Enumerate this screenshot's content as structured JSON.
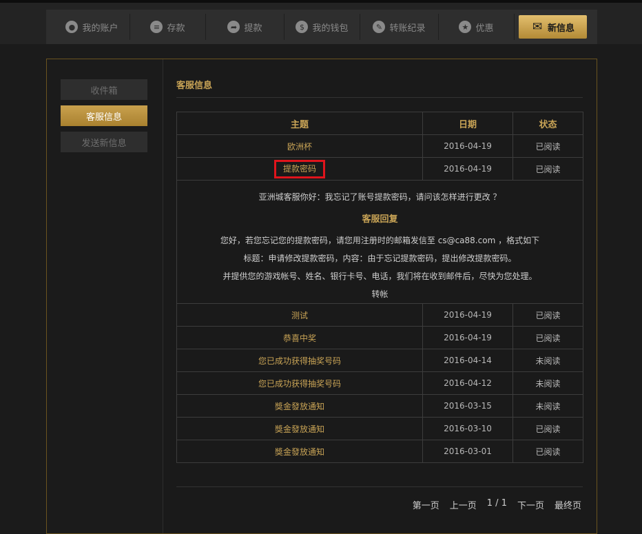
{
  "nav": {
    "items": [
      {
        "label": "我的账户",
        "icon": "user-icon"
      },
      {
        "label": "存款",
        "icon": "coins-icon"
      },
      {
        "label": "提款",
        "icon": "withdraw-arrow-icon"
      },
      {
        "label": "我的钱包",
        "icon": "dollar-icon"
      },
      {
        "label": "转账纪录",
        "icon": "pencil-icon"
      },
      {
        "label": "优惠",
        "icon": "star-icon"
      }
    ],
    "active": {
      "label": "新信息",
      "icon": "envelope-icon"
    }
  },
  "sidebar": {
    "items": [
      "收件箱",
      "客服信息",
      "发送新信息"
    ],
    "active_index": 1
  },
  "section_title": "客服信息",
  "table": {
    "headers": {
      "subject": "主题",
      "date": "日期",
      "status": "状态"
    },
    "rows_before": [
      {
        "subject": "欧洲杯",
        "date": "2016-04-19",
        "status": "已阅读"
      },
      {
        "subject": "提款密码",
        "date": "2016-04-19",
        "status": "已阅读"
      }
    ],
    "detail": {
      "question": "亚洲城客服你好：我忘记了账号提款密码，请问该怎样进行更改 ？",
      "reply_heading": "客服回复",
      "reply_lines": [
        "您好，若您忘记您的提款密码，请您用注册时的邮箱发信至 cs@ca88.com ，格式如下",
        "标题：申请修改提款密码，内容：由于忘记提款密码，提出修改提款密码。",
        "并提供您的游戏帐号、姓名、银行卡号、电话，我们将在收到邮件后，尽快为您处理。",
        "转帐"
      ]
    },
    "rows_after": [
      {
        "subject": "测试",
        "date": "2016-04-19",
        "status": "已阅读"
      },
      {
        "subject": "恭喜中奖",
        "date": "2016-04-19",
        "status": "已阅读"
      },
      {
        "subject": "您已成功获得抽奖号码",
        "date": "2016-04-14",
        "status": "未阅读"
      },
      {
        "subject": "您已成功获得抽奖号码",
        "date": "2016-04-12",
        "status": "未阅读"
      },
      {
        "subject": "獎金發放通知",
        "date": "2016-03-15",
        "status": "未阅读"
      },
      {
        "subject": "獎金發放通知",
        "date": "2016-03-10",
        "status": "已阅读"
      },
      {
        "subject": "獎金發放通知",
        "date": "2016-03-01",
        "status": "已阅读"
      }
    ]
  },
  "pager": {
    "first": "第一页",
    "prev": "上一页",
    "page": "1 / 1",
    "next": "下一页",
    "last": "最终页"
  },
  "colors": {
    "accent": "#c9a456",
    "highlight_box": "#e0141c",
    "background": "#1b1b1b"
  }
}
